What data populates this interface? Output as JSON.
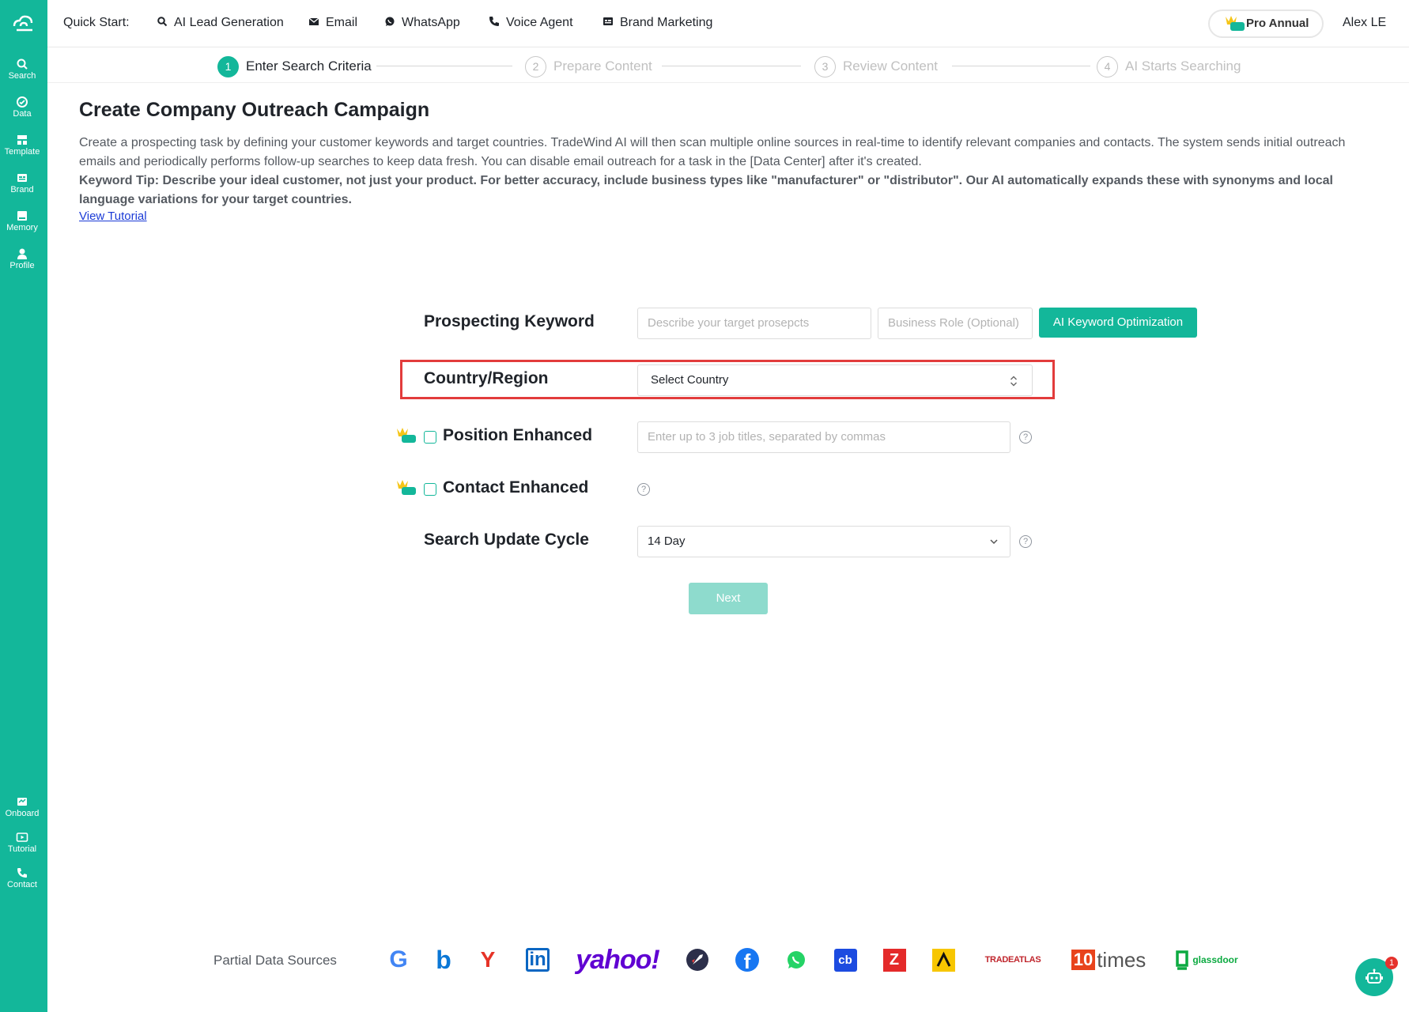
{
  "sidebar": {
    "top_items": [
      {
        "label": "Search",
        "icon": "search-icon"
      },
      {
        "label": "Data",
        "icon": "data-icon"
      },
      {
        "label": "Template",
        "icon": "template-icon"
      },
      {
        "label": "Brand",
        "icon": "brand-icon"
      },
      {
        "label": "Memory",
        "icon": "memory-icon"
      },
      {
        "label": "Profile",
        "icon": "profile-icon"
      }
    ],
    "bottom_items": [
      {
        "label": "Onboard",
        "icon": "onboard-icon"
      },
      {
        "label": "Tutorial",
        "icon": "tutorial-icon"
      },
      {
        "label": "Contact",
        "icon": "phone-icon"
      }
    ]
  },
  "topbar": {
    "quick_start_label": "Quick Start:",
    "items": [
      {
        "label": "AI Lead Generation",
        "icon": "search-icon"
      },
      {
        "label": "Email",
        "icon": "mail-icon"
      },
      {
        "label": "WhatsApp",
        "icon": "whatsapp-icon"
      },
      {
        "label": "Voice Agent",
        "icon": "phone-icon"
      },
      {
        "label": "Brand Marketing",
        "icon": "brand-icon"
      }
    ],
    "plan_badge": "Pro",
    "plan_label": "Pro Annual",
    "user_name": "Alex LE"
  },
  "steps": [
    {
      "num": "1",
      "label": "Enter Search Criteria",
      "active": true
    },
    {
      "num": "2",
      "label": "Prepare Content",
      "active": false
    },
    {
      "num": "3",
      "label": "Review Content",
      "active": false
    },
    {
      "num": "4",
      "label": "AI Starts Searching",
      "active": false
    }
  ],
  "intro": {
    "title": "Create Company Outreach Campaign",
    "description": "Create a prospecting task by defining your customer keywords and target countries. TradeWind AI will then scan multiple online sources in real-time to identify relevant companies and contacts. The system sends initial outreach emails and periodically performs follow-up searches to keep data fresh. You can disable email outreach for a task in the [Data Center] after it's created.",
    "tip": "Keyword Tip: Describe your ideal customer, not just your product. For better accuracy, include business types like \"manufacturer\" or \"distributor\". Our AI automatically expands these with synonyms and local language variations for your target countries.",
    "tutorial_link": "View Tutorial"
  },
  "form": {
    "keyword": {
      "label": "Prospecting Keyword",
      "placeholder": "Describe your target prosepcts",
      "role_placeholder": "Business Role (Optional)",
      "ai_button": "AI Keyword Optimization"
    },
    "country": {
      "label": "Country/Region",
      "value": "Select Country"
    },
    "position": {
      "label": "Position Enhanced",
      "badge": "Pro",
      "placeholder": "Enter up to 3 job titles, separated by commas",
      "help": "?"
    },
    "contact": {
      "label": "Contact Enhanced",
      "badge": "Pro",
      "help": "?"
    },
    "cycle": {
      "label": "Search Update Cycle",
      "value": "14 Day",
      "help": "?"
    },
    "next_button": "Next"
  },
  "sources": {
    "label": "Partial Data Sources",
    "items": [
      {
        "text": "G",
        "icon": "google-icon"
      },
      {
        "text": "b",
        "icon": "bing-icon"
      },
      {
        "text": "Y",
        "icon": "yandex-icon"
      },
      {
        "text": "in",
        "icon": "linkedin-icon"
      },
      {
        "text": "yahoo!",
        "icon": "yahoo-icon"
      },
      {
        "text": "",
        "icon": "rocket-icon"
      },
      {
        "text": "f",
        "icon": "facebook-icon"
      },
      {
        "text": "",
        "icon": "whatsapp-icon"
      },
      {
        "text": "cb",
        "icon": "crunchbase-icon"
      },
      {
        "text": "Z",
        "icon": "zoominfo-icon"
      },
      {
        "text": "",
        "icon": "apollo-icon"
      },
      {
        "text": "TRADEATLAS",
        "icon": "tradeatlas-icon"
      },
      {
        "text": "10",
        "text2": "times",
        "icon": "10times-icon"
      },
      {
        "text": "glassdoor",
        "icon": "glassdoor-icon"
      }
    ]
  },
  "chat": {
    "badge_count": "1"
  },
  "colors": {
    "brand": "#13b79a",
    "highlight": "#e23c3c",
    "link": "#1a3ad6"
  }
}
